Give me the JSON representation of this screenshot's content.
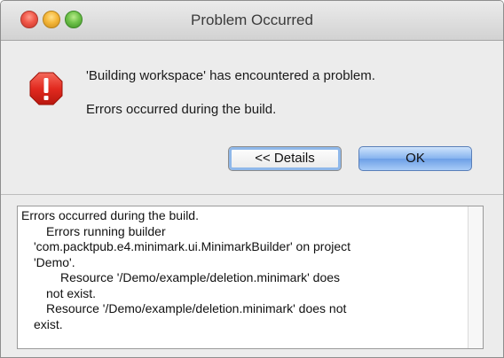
{
  "window": {
    "title": "Problem Occurred"
  },
  "dialog": {
    "icon": "exclamation-alert-icon",
    "message_primary": "'Building workspace' has encountered a problem.",
    "message_secondary": "Errors occurred during the build."
  },
  "buttons": {
    "details_label": "<< Details",
    "ok_label": "OK"
  },
  "details": {
    "lines": [
      "Errors occurred during the build.",
      "Errors running builder",
      "'com.packtpub.e4.minimark.ui.MinimarkBuilder' on project",
      "'Demo'.",
      "Resource '/Demo/example/deletion.minimark' does",
      "not exist.",
      "Resource '/Demo/example/deletion.minimark' does not",
      "exist."
    ]
  },
  "colors": {
    "alert_red": "#e22a1f",
    "ok_button_blue": "#86b3ef",
    "window_background": "#ececec"
  }
}
